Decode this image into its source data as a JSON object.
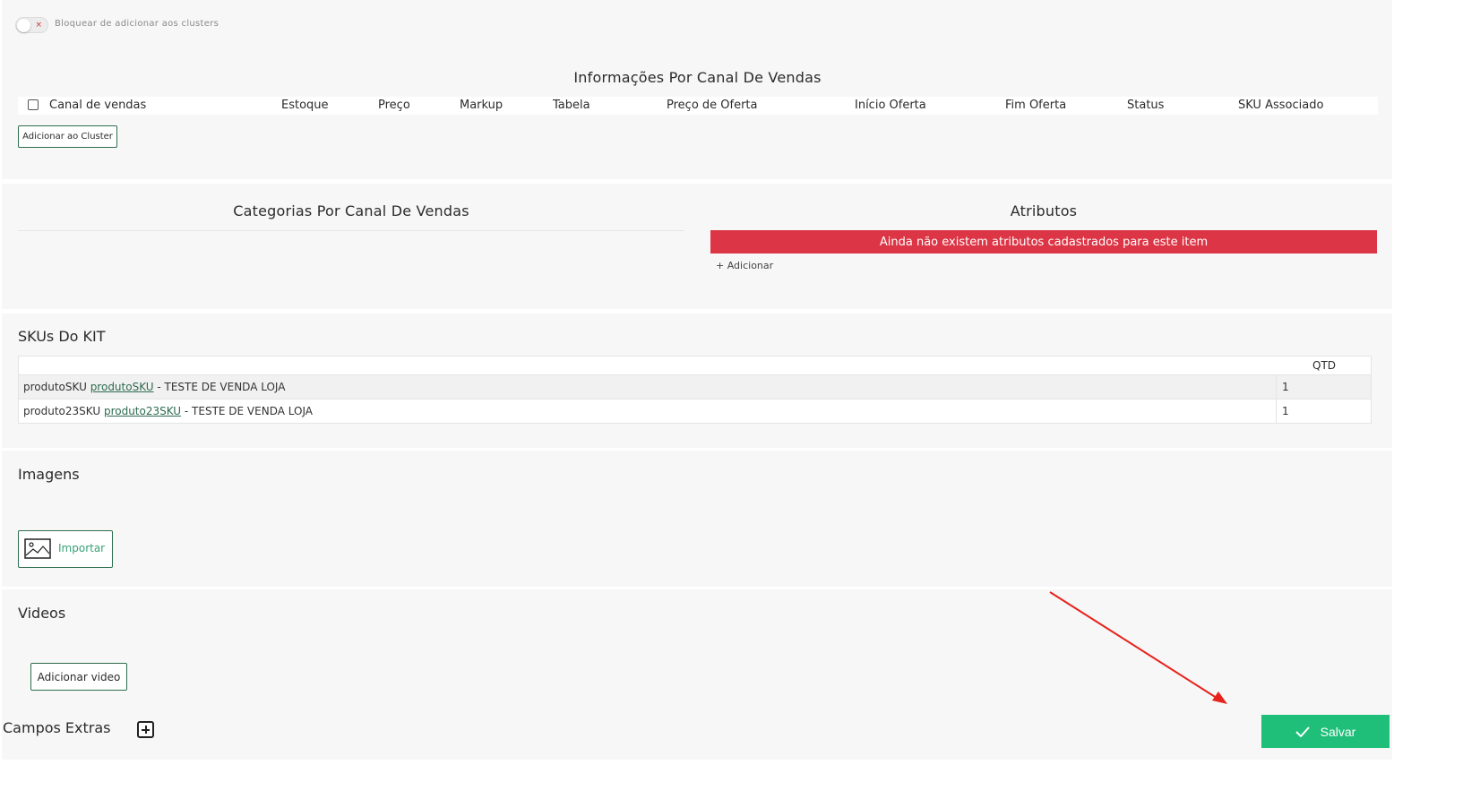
{
  "toggle": {
    "label": "Bloquear de adicionar aos clusters"
  },
  "sales_channel": {
    "title": "Informações Por Canal De Vendas",
    "columns": [
      "Canal de vendas",
      "Estoque",
      "Preço",
      "Markup",
      "Tabela",
      "Preço de Oferta",
      "Início Oferta",
      "Fim Oferta",
      "Status",
      "SKU Associado"
    ],
    "add_cluster_label": "Adicionar ao Cluster"
  },
  "categories": {
    "title": "Categorias Por Canal De Vendas"
  },
  "attributes": {
    "title": "Atributos",
    "empty_message": "Ainda não existem atributos cadastrados para este item",
    "add_label": "+ Adicionar"
  },
  "kit": {
    "title": "SKUs Do KIT",
    "qty_header": "QTD",
    "rows": [
      {
        "img_alt": "produtoSKU",
        "link": "produtoSKU",
        "desc": " - TESTE DE VENDA LOJA",
        "qty": "1"
      },
      {
        "img_alt": "produto23SKU",
        "link": "produto23SKU",
        "desc": " - TESTE DE VENDA LOJA",
        "qty": "1"
      }
    ]
  },
  "images": {
    "title": "Imagens",
    "import_label": "Importar"
  },
  "videos": {
    "title": "Videos",
    "add_label": "Adicionar video"
  },
  "extra_fields": {
    "title": "Campos Extras"
  },
  "save": {
    "label": "Salvar"
  },
  "colors": {
    "accent": "#1fbf7a",
    "alert": "#dc3545",
    "annotation_arrow": "#e8221c"
  },
  "icons": [
    "close-icon",
    "image-icon",
    "plus-square-icon",
    "check-icon"
  ]
}
